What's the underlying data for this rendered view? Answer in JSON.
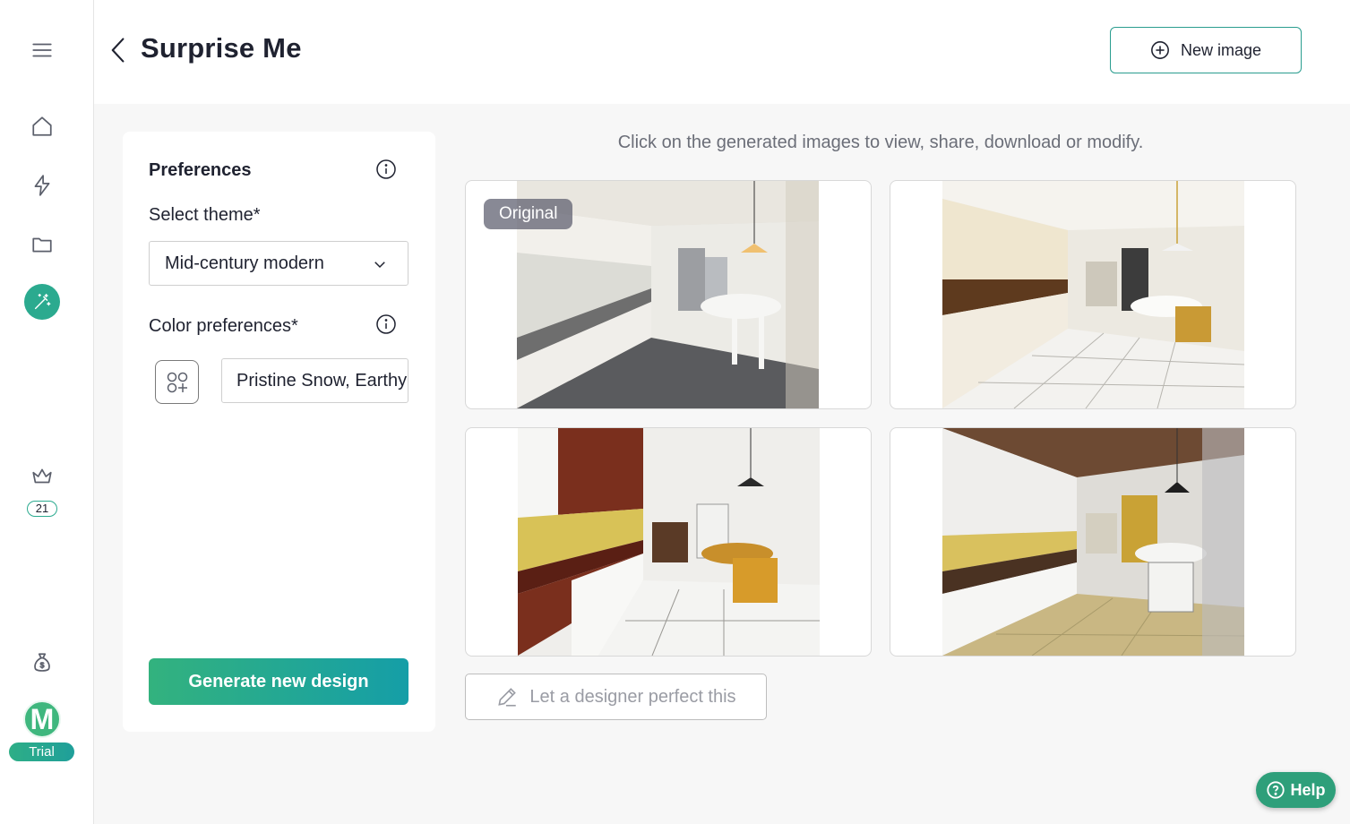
{
  "sidebar": {
    "icons": [
      "menu-icon",
      "home-icon",
      "lightning-icon",
      "folder-icon",
      "magic-wand-icon",
      "crown-icon",
      "money-bag-icon"
    ],
    "credits": "21",
    "avatar_letter": "M",
    "plan_badge": "Trial"
  },
  "header": {
    "title": "Surprise Me",
    "new_image_label": "New image"
  },
  "preferences": {
    "title": "Preferences",
    "theme_label": "Select theme*",
    "theme_value": "Mid-century modern",
    "color_label": "Color preferences*",
    "color_value": "Pristine Snow, Earthy Brown",
    "generate_label": "Generate new design"
  },
  "results": {
    "hint": "Click on the generated images to view, share, download or modify.",
    "original_badge": "Original",
    "images": [
      {
        "caption": "kitchen-render-original"
      },
      {
        "caption": "kitchen-render-variant-1"
      },
      {
        "caption": "kitchen-render-variant-2"
      },
      {
        "caption": "kitchen-render-variant-3"
      }
    ],
    "designer_label": "Let a designer perfect this"
  },
  "help_label": "Help",
  "colors": {
    "accent": "#2baa8f",
    "gradient_start": "#33b27e",
    "gradient_end": "#159ea7",
    "text": "#1f2230"
  }
}
